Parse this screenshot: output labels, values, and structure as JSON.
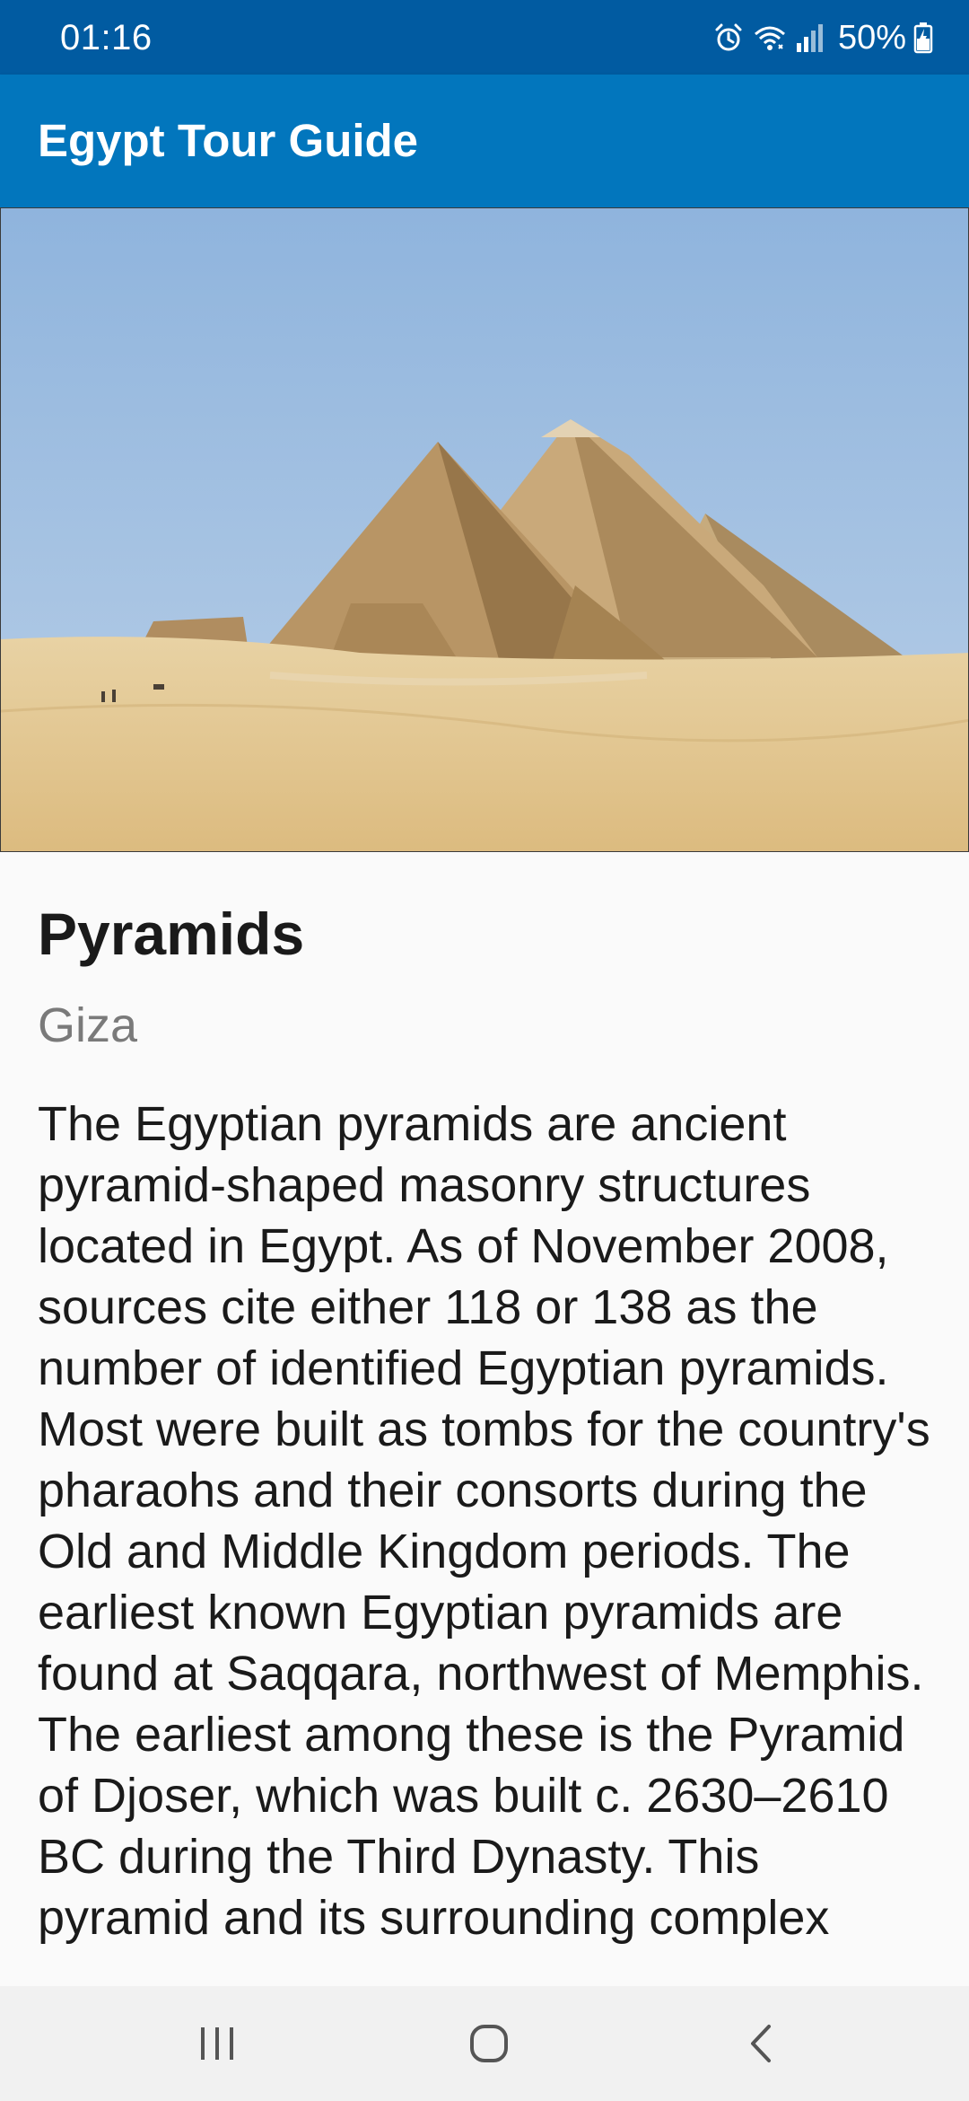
{
  "status_bar": {
    "time": "01:16",
    "battery": "50%",
    "icons": [
      "alarm-icon",
      "wifi-icon",
      "signal-icon",
      "battery-charging-icon"
    ],
    "background": "#015ba1"
  },
  "app_bar": {
    "title": "Egypt Tour Guide",
    "background": "#0276bd"
  },
  "hero_image": {
    "subject": "pyramids-of-giza-photo"
  },
  "place": {
    "name": "Pyramids",
    "location": "Giza",
    "description": "The Egyptian pyramids are ancient pyramid-shaped masonry structures located in Egypt. As of November 2008, sources cite either 118 or 138 as the number of identified Egyptian pyramids. Most were built as tombs for the country's pharaohs and their consorts during the Old and Middle Kingdom periods. The earliest known Egyptian pyramids are found at Saqqara, northwest of Memphis. The earliest among these is the Pyramid of Djoser, which was built c. 2630–2610 BC during the Third Dynasty. This pyramid and its surrounding complex"
  },
  "nav_bar": {
    "buttons": [
      "recent-apps-icon",
      "home-icon",
      "back-icon"
    ]
  }
}
